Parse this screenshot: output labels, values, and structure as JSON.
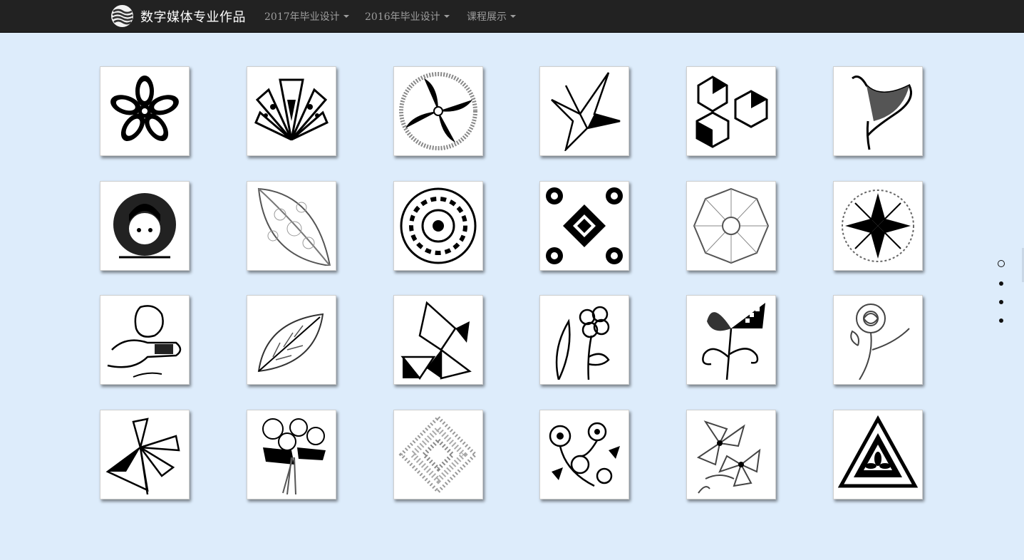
{
  "brand": {
    "title": "数字媒体专业作品",
    "logo_icon": "wave-globe-logo-icon"
  },
  "nav": [
    {
      "label": "2017年毕业设计"
    },
    {
      "label": "2016年毕业设计"
    },
    {
      "label": "课程展示"
    }
  ],
  "gallery": {
    "items": [
      "flower-mandala",
      "geometric-fan-flower",
      "circle-ring-mandala",
      "paper-crane",
      "isometric-cubes",
      "calla-lily",
      "girl-portrait",
      "ornate-leaf",
      "circular-mandala",
      "square-swirl-mandala",
      "line-mandala",
      "lotus-mandala",
      "lion-sketch",
      "feather",
      "geometric-tangram",
      "doodle-flower",
      "checkered-butterfly-flower",
      "rose",
      "kite-petal-flower",
      "bouquet",
      "dotted-diamond",
      "scroll-flowers",
      "lily-bunch",
      "triangle-mandala"
    ]
  },
  "pager": {
    "count": 4,
    "active_index": 0
  },
  "colors": {
    "navbar": "#222222",
    "page_bg": "#ddecfb",
    "nav_text": "#9d9d9d",
    "brand_text": "#ffffff"
  }
}
